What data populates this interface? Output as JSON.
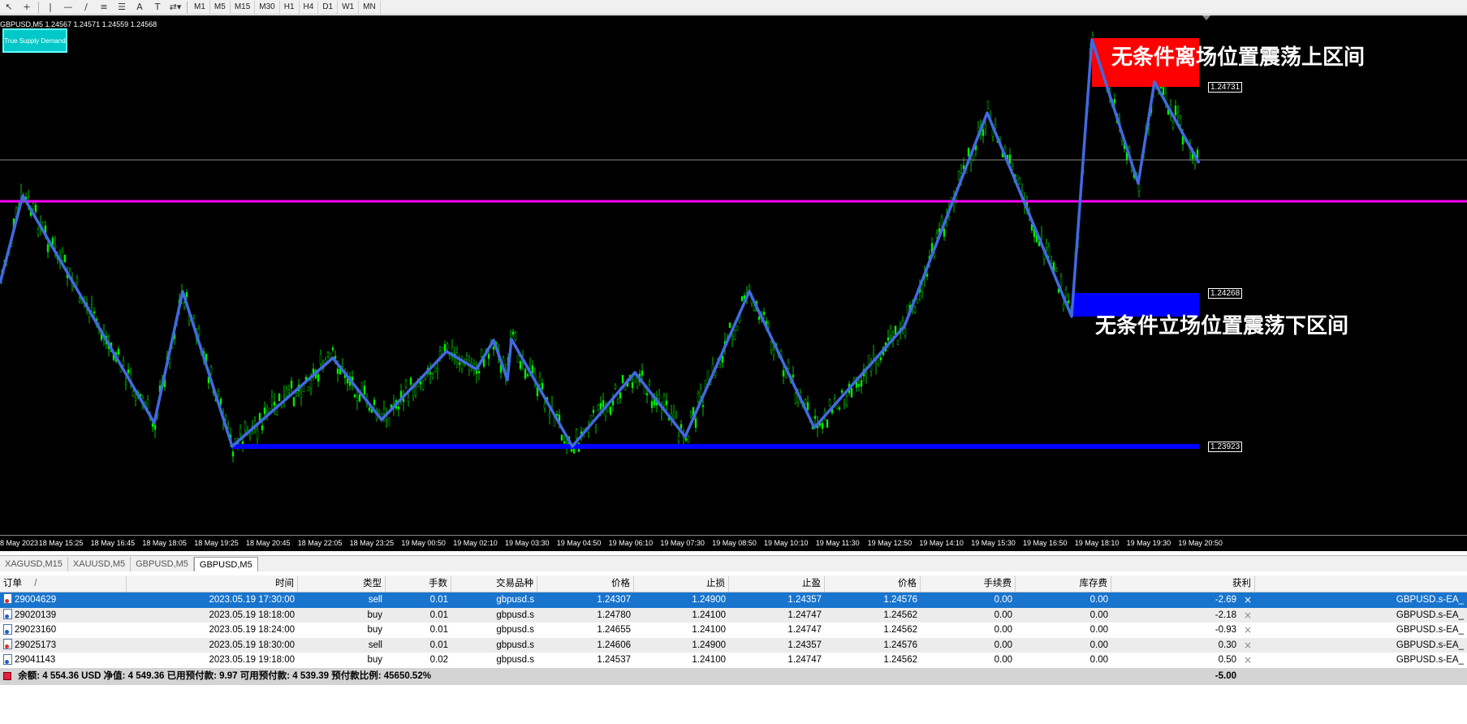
{
  "toolbar": {
    "tools": [
      "cursor-icon",
      "crosshair-icon",
      "vertical-line-icon",
      "horizontal-line-icon",
      "trendline-icon",
      "fibonacci-icon",
      "channel-icon",
      "text-icon",
      "label-icon",
      "arrows-icon"
    ],
    "timeframes": [
      "M1",
      "M5",
      "M15",
      "M30",
      "H1",
      "H4",
      "D1",
      "W1",
      "MN"
    ]
  },
  "chart": {
    "symbol_info": "GBPUSD,M5  1.24567 1.24571 1.24559 1.24568",
    "indicator_button": "True Supply Demand",
    "price_labels": {
      "top": "1.24731",
      "mid": "1.24268",
      "bottom": "1.23923"
    },
    "zone_upper_text": "无条件离场位置震荡上区间",
    "zone_lower_text": "无条件立场位置震荡下区间",
    "colors": {
      "background": "#000000",
      "candle": "#00d000",
      "zigzag": "#4169e1",
      "magenta_line": "#ff00ff",
      "upper_zone": "#ff0000",
      "lower_zone": "#0000ff",
      "bottom_line": "#0000ff"
    },
    "time_labels": [
      "8 May 2023",
      "18 May 15:25",
      "18 May 16:45",
      "18 May 18:05",
      "18 May 19:25",
      "18 May 20:45",
      "18 May 22:05",
      "18 May 23:25",
      "19 May 00:50",
      "19 May 02:10",
      "19 May 03:30",
      "19 May 04:50",
      "19 May 06:10",
      "19 May 07:30",
      "19 May 08:50",
      "19 May 10:10",
      "19 May 11:30",
      "19 May 12:50",
      "19 May 14:10",
      "19 May 15:30",
      "19 May 16:50",
      "19 May 18:10",
      "19 May 19:30",
      "19 May 20:50"
    ]
  },
  "tabs": [
    "XAGUSD,M15",
    "XAUUSD,M5",
    "GBPUSD,M5",
    "GBPUSD,M5"
  ],
  "active_tab_index": 3,
  "orders": {
    "headers": {
      "order": "订单",
      "sort": "/",
      "time": "时间",
      "type": "类型",
      "lots": "手数",
      "symbol": "交易品种",
      "price": "价格",
      "sl": "止损",
      "tp": "止盈",
      "price2": "价格",
      "commission": "手续费",
      "swap": "库存费",
      "profit": "获利"
    },
    "rows": [
      {
        "order": "29004629",
        "time": "2023.05.19 17:30:00",
        "type": "sell",
        "lots": "0.01",
        "symbol": "gbpusd.s",
        "price": "1.24307",
        "sl": "1.24900",
        "tp": "1.24357",
        "price2": "1.24576",
        "commission": "0.00",
        "swap": "0.00",
        "profit": "-2.69",
        "comment": "GBPUSD.s-EA_"
      },
      {
        "order": "29020139",
        "time": "2023.05.19 18:18:00",
        "type": "buy",
        "lots": "0.01",
        "symbol": "gbpusd.s",
        "price": "1.24780",
        "sl": "1.24100",
        "tp": "1.24747",
        "price2": "1.24562",
        "commission": "0.00",
        "swap": "0.00",
        "profit": "-2.18",
        "comment": "GBPUSD.s-EA_"
      },
      {
        "order": "29023160",
        "time": "2023.05.19 18:24:00",
        "type": "buy",
        "lots": "0.01",
        "symbol": "gbpusd.s",
        "price": "1.24655",
        "sl": "1.24100",
        "tp": "1.24747",
        "price2": "1.24562",
        "commission": "0.00",
        "swap": "0.00",
        "profit": "-0.93",
        "comment": "GBPUSD.s-EA_"
      },
      {
        "order": "29025173",
        "time": "2023.05.19 18:30:00",
        "type": "sell",
        "lots": "0.01",
        "symbol": "gbpusd.s",
        "price": "1.24606",
        "sl": "1.24900",
        "tp": "1.24357",
        "price2": "1.24576",
        "commission": "0.00",
        "swap": "0.00",
        "profit": "0.30",
        "comment": "GBPUSD.s-EA_"
      },
      {
        "order": "29041143",
        "time": "2023.05.19 19:18:00",
        "type": "buy",
        "lots": "0.02",
        "symbol": "gbpusd.s",
        "price": "1.24537",
        "sl": "1.24100",
        "tp": "1.24747",
        "price2": "1.24562",
        "commission": "0.00",
        "swap": "0.00",
        "profit": "0.50",
        "comment": "GBPUSD.s-EA_"
      }
    ],
    "summary": {
      "text": "余额: 4 554.36 USD  净值: 4 549.36  已用预付款: 9.97  可用预付款: 4 539.39  预付款比例: 45650.52%",
      "profit": "-5.00"
    }
  }
}
